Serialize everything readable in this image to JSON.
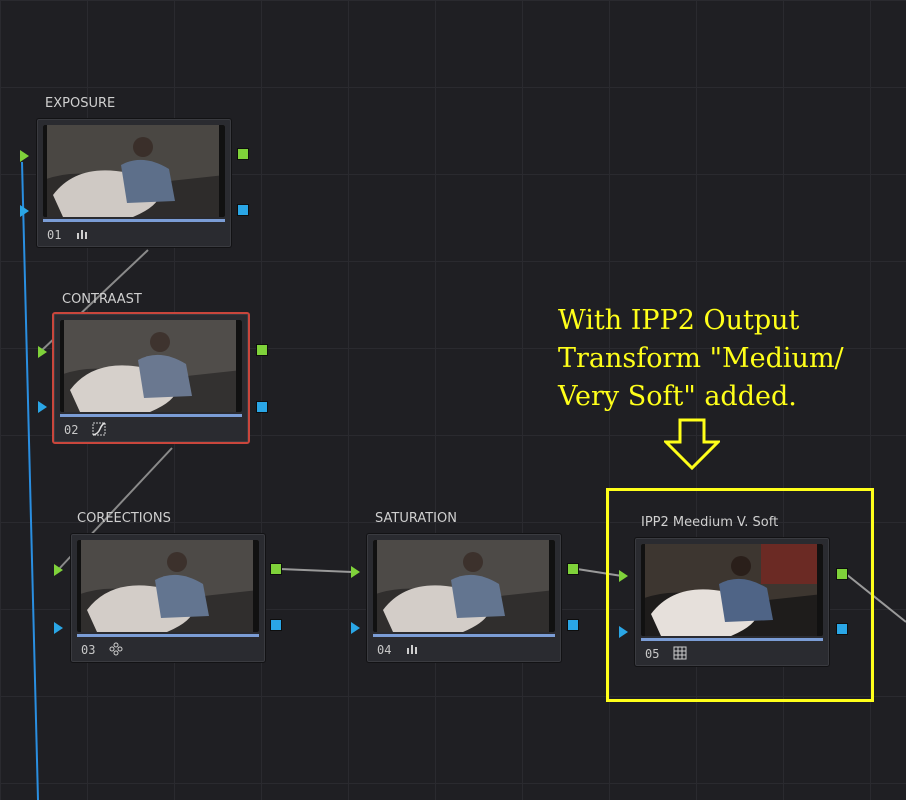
{
  "nodes": [
    {
      "title": "EXPOSURE",
      "number": "01",
      "icon": "bar-chart-icon"
    },
    {
      "title": "CONTRAAST",
      "number": "02",
      "icon": "curve-icon"
    },
    {
      "title": "COREECTIONS",
      "number": "03",
      "icon": "color-wheels-icon"
    },
    {
      "title": "SATURATION",
      "number": "04",
      "icon": "bar-chart-icon"
    },
    {
      "title": "IPP2 Meedium V. Soft",
      "number": "05",
      "icon": "lut-grid-icon"
    }
  ],
  "annotation": {
    "lines": [
      "With IPP2 Output",
      "Transform \"Medium/",
      "Very Soft\" added."
    ],
    "color": "#ffff1a"
  },
  "colors": {
    "rgb_port": "#7fd23a",
    "alpha_port": "#2aa6e6",
    "selected_border": "#c9463c",
    "wire": "#9a9a9a",
    "key_wire": "#2a8ee0"
  }
}
